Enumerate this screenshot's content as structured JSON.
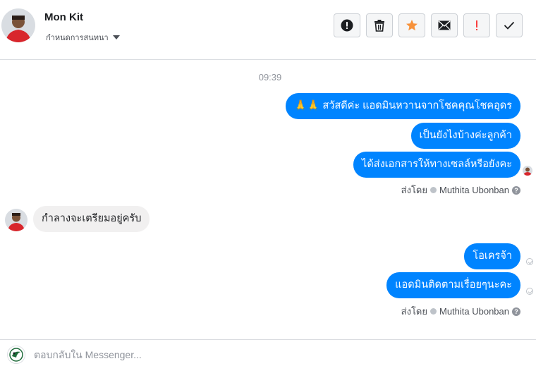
{
  "header": {
    "contact_name": "Mon Kit",
    "conversation_settings": "กำหนดการสนทนา",
    "toolbar": [
      "alert-circle-icon",
      "trash-icon",
      "star-icon",
      "mail-icon",
      "exclamation-icon",
      "checkmark-icon"
    ]
  },
  "thread": {
    "timestamp": "09:39",
    "messages": [
      {
        "direction": "out",
        "text": "🙏🙏 สวัสดีค่ะ แอดมินหวานจากโชคคุณโชคอุดร"
      },
      {
        "direction": "out",
        "text": "เป็นยังไงบ้างค่ะลูกค้า"
      },
      {
        "direction": "out",
        "text": "ได้ส่งเอกสารให้ทางเซลล์หรือยังคะ"
      },
      {
        "direction": "in",
        "text": "กำลางจะเตรียมอยู่ครับ"
      },
      {
        "direction": "out",
        "text": "โอเครจ้า"
      },
      {
        "direction": "out",
        "text": "แอดมินติดตามเรื่อยๆนะคะ"
      }
    ],
    "sent_by_label": "ส่งโดย",
    "sent_by_name": "Muthita Ubonban",
    "help_glyph": "?"
  },
  "composer": {
    "placeholder": "ตอบกลับใน Messenger..."
  },
  "colors": {
    "outgoing_bubble": "#0084ff",
    "incoming_bubble": "#f1f0f0",
    "star": "#f7923b",
    "alert": "#fa3e3e"
  }
}
